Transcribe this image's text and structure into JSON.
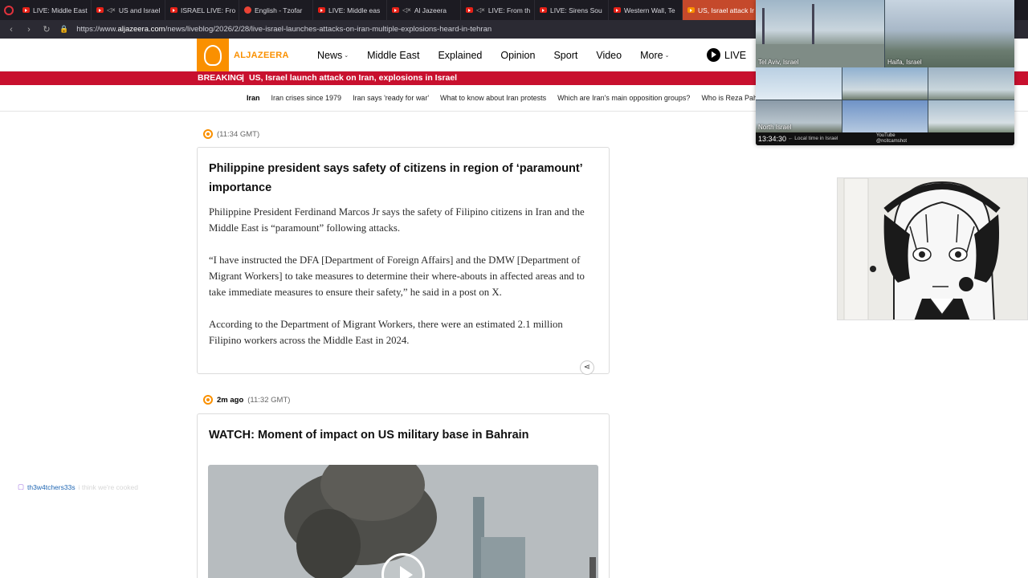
{
  "browser": {
    "tabs": [
      {
        "label": "LIVE: Middle East",
        "icon": "youtube-icon"
      },
      {
        "label": "US and Israel",
        "icon": "youtube-icon",
        "muted": true
      },
      {
        "label": "ISRAEL LIVE: Fro",
        "icon": "youtube-icon"
      },
      {
        "label": "English - Tzofar",
        "icon": "google-icon"
      },
      {
        "label": "LIVE: Middle eas",
        "icon": "youtube-icon"
      },
      {
        "label": "Al Jazeera",
        "icon": "youtube-icon",
        "muted": true
      },
      {
        "label": "LIVE: From th",
        "icon": "youtube-icon",
        "muted": true
      },
      {
        "label": "LIVE: Sirens Sou",
        "icon": "youtube-icon"
      },
      {
        "label": "Western Wall, Te",
        "icon": "youtube-icon"
      },
      {
        "label": "US, Israel attack Ir",
        "icon": "aljazeera-icon",
        "active": true
      }
    ],
    "url_prefix": "https://www.",
    "url_domain": "aljazeera.com",
    "url_path": "/news/liveblog/2026/2/28/live-israel-launches-attacks-on-iran-multiple-explosions-heard-in-tehran"
  },
  "site": {
    "logo_text": "ALJAZEERA",
    "nav": [
      "News",
      "Middle East",
      "Explained",
      "Opinion",
      "Sport",
      "Video",
      "More"
    ],
    "live_label": "LIVE",
    "brand_color": "#fa9000",
    "breaking_label": "BREAKING",
    "breaking_text": "US, Israel launch attack on Iran, explosions in Israel",
    "breaking_color": "#c8102e",
    "topics": [
      "Iran",
      "Iran crises since 1979",
      "Iran says 'ready for war'",
      "What to know about Iran protests",
      "Which are Iran's main opposition groups?",
      "Who is Reza Pah"
    ]
  },
  "liveblog": {
    "post1": {
      "time": "(11:34 GMT)",
      "title": "Philippine president says safety of citizens in region of ‘paramount’ importance",
      "paragraphs": [
        "Philippine President Ferdinand Marcos Jr says the safety of Filipino citizens in Iran and the Middle East is “paramount” following attacks.",
        "“I have instructed the DFA [Department of Foreign Affairs] and the DMW [Department of Migrant Workers] to take measures to determine their where-abouts in affected areas and to take immediate measures to ensure their safety,” he said in a post on X.",
        "According to the Department of Migrant Workers, there were an estimated 2.1 million Filipino workers across the Middle East in 2024."
      ]
    },
    "post2": {
      "ago": "2m ago",
      "time": "(11:32 GMT)",
      "title": "WATCH: Moment of impact on US military base in Bahrain"
    }
  },
  "overlay": {
    "cams": [
      "Tel Aviv, Israel",
      "Haifa, Israel",
      "North Israel"
    ],
    "clock": "13:34:30",
    "clock_caption": "← Local time in Israel",
    "footer_source": "YouTube",
    "footer_handle": "@ncitcamshot"
  },
  "chat": {
    "username": "th3w4tchers33s",
    "message": "i think we're cooked"
  }
}
